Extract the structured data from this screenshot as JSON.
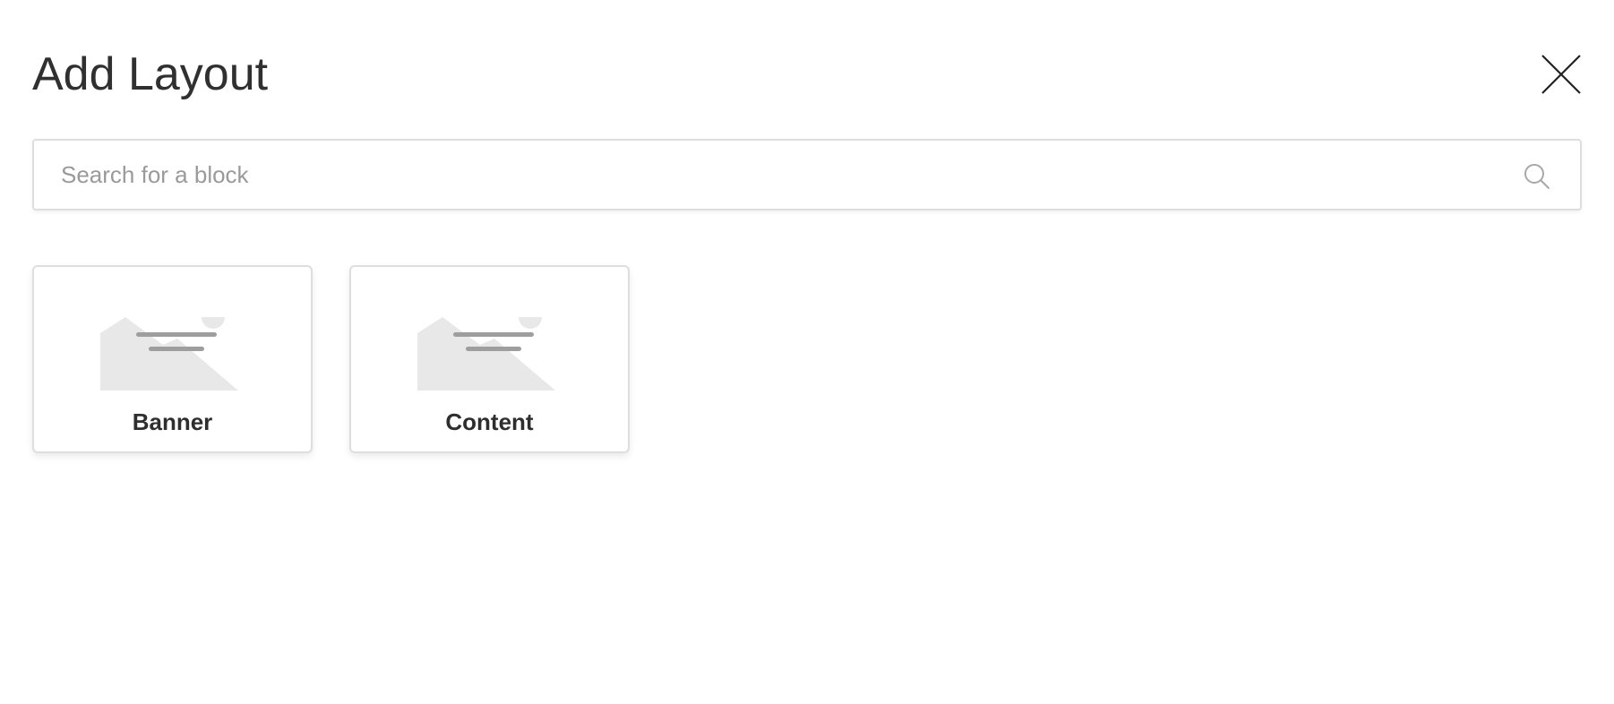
{
  "modal": {
    "title": "Add Layout",
    "close_icon": "close-icon"
  },
  "search": {
    "placeholder": "Search for a block",
    "value": "",
    "icon": "search-icon"
  },
  "blocks": [
    {
      "label": "Banner",
      "icon": "image-placeholder-icon"
    },
    {
      "label": "Content",
      "icon": "image-placeholder-icon"
    }
  ],
  "colors": {
    "title_text": "#303030",
    "border": "#dedede",
    "placeholder_text": "#9a9a9a",
    "thumb_fill": "#e8e8e8",
    "thumb_lines": "#9e9e9e"
  }
}
